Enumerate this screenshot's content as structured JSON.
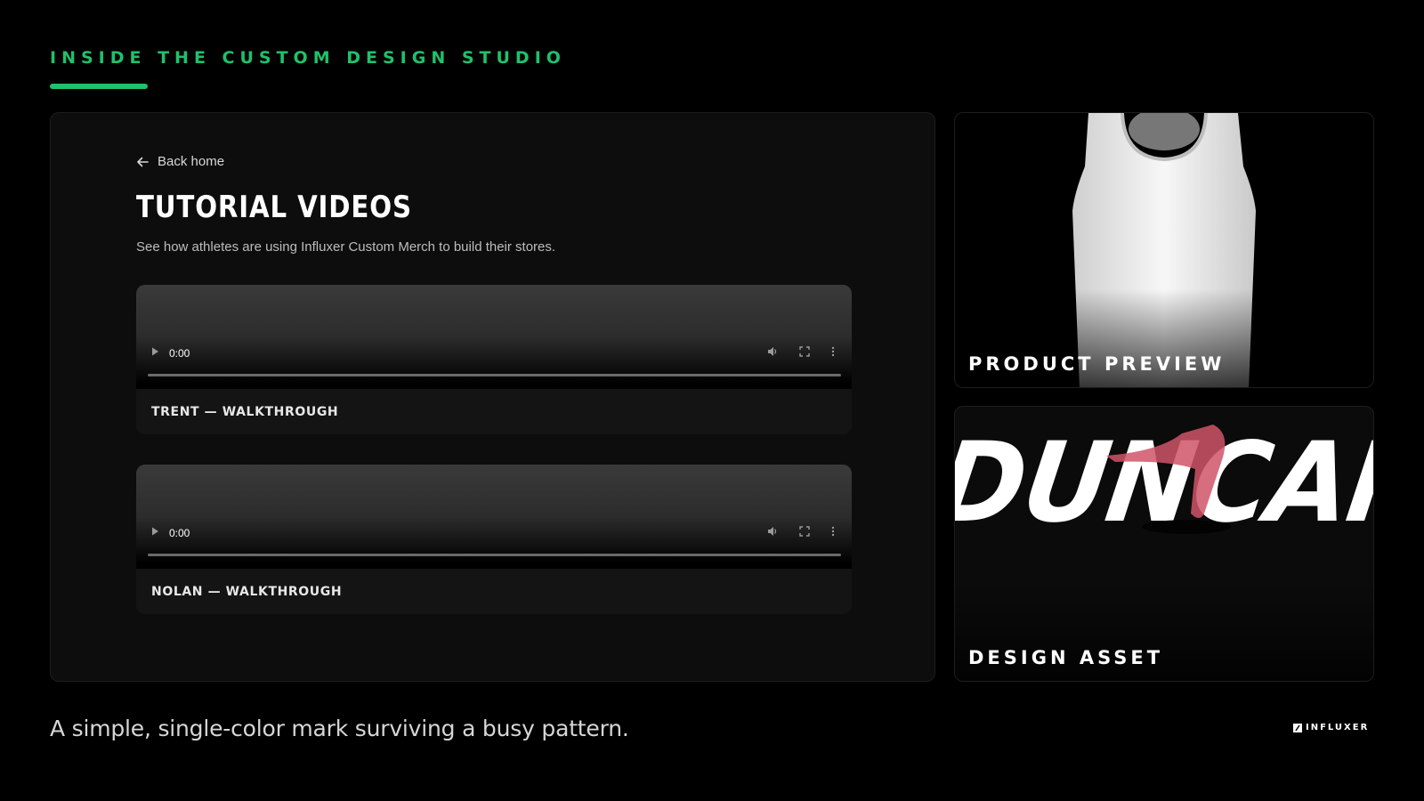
{
  "header": {
    "eyebrow": "INSIDE THE CUSTOM DESIGN STUDIO",
    "accent_color": "#1fc16b"
  },
  "main": {
    "back_link": "Back home",
    "title": "TUTORIAL VIDEOS",
    "subtitle": "See how athletes are using Influxer Custom Merch to build their stores.",
    "videos": [
      {
        "time": "0:00",
        "label": "TRENT — WALKTHROUGH"
      },
      {
        "time": "0:00",
        "label": "NOLAN — WALKTHROUGH"
      }
    ]
  },
  "side": {
    "cards": [
      {
        "label": "PRODUCT PREVIEW",
        "art": "white tank top"
      },
      {
        "label": "DESIGN ASSET",
        "art_text": "DUNCAN"
      }
    ]
  },
  "footer": {
    "caption": "A simple, single-color mark surviving a busy pattern.",
    "logo_text": "INFLUXER"
  }
}
